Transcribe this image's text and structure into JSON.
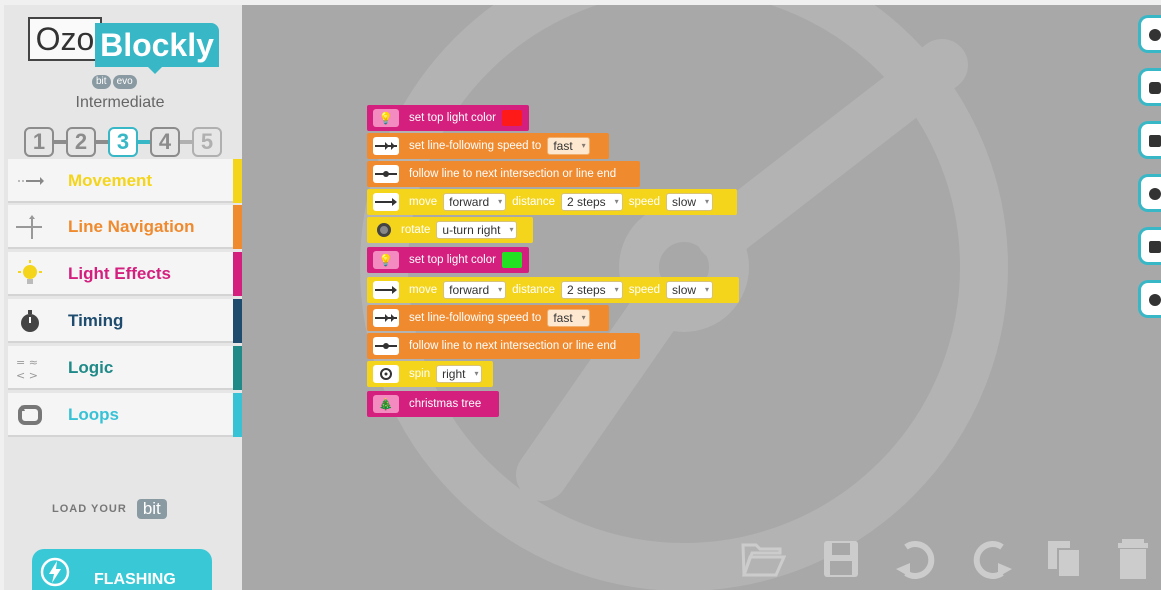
{
  "brand": {
    "ozo": "Ozo",
    "blockly": "Blockly",
    "bit": "bit",
    "evo": "evo"
  },
  "level": {
    "name": "Intermediate",
    "numbers": [
      "1",
      "2",
      "3",
      "4",
      "5"
    ],
    "active": "3"
  },
  "categories": [
    {
      "label": "Movement",
      "color": "#f4d51b",
      "icon": "movement-arrow-icon"
    },
    {
      "label": "Line Navigation",
      "color": "#f08a2e",
      "icon": "line-navigation-icon"
    },
    {
      "label": "Light Effects",
      "color": "#d41f7e",
      "icon": "light-bulb-icon"
    },
    {
      "label": "Timing",
      "color": "#1e4c6e",
      "icon": "stopwatch-icon"
    },
    {
      "label": "Logic",
      "color": "#1f8a88",
      "icon": "logic-icon"
    },
    {
      "label": "Loops",
      "color": "#38c2d6",
      "icon": "loop-icon"
    }
  ],
  "load": {
    "label": "LOAD YOUR",
    "bit": "bit"
  },
  "flash": {
    "label": "FLASHING"
  },
  "blocks": [
    {
      "type": "light",
      "text": "set top light color",
      "swatch": "#ff1a1a"
    },
    {
      "type": "speed",
      "text": "set line-following speed to",
      "value": "fast"
    },
    {
      "type": "follow",
      "text": "follow line to next intersection or line end"
    },
    {
      "type": "move",
      "t1": "move",
      "v1": "forward",
      "t2": "distance",
      "v2": "2 steps",
      "t3": "speed",
      "v3": "slow"
    },
    {
      "type": "rotate",
      "text": "rotate",
      "value": "u-turn right"
    },
    {
      "type": "light",
      "text": "set top light color",
      "swatch": "#22e022"
    },
    {
      "type": "move",
      "t1": "move",
      "v1": "forward",
      "t2": "distance",
      "v2": "2 steps",
      "t3": "speed",
      "v3": "slow"
    },
    {
      "type": "speed",
      "text": "set line-following speed to",
      "value": "fast"
    },
    {
      "type": "follow",
      "text": "follow line to next intersection or line end"
    },
    {
      "type": "spin",
      "text": "spin",
      "value": "right"
    },
    {
      "type": "tree",
      "text": "christmas tree"
    }
  ],
  "toolbar": [
    "open-folder-icon",
    "save-icon",
    "undo-icon",
    "redo-icon",
    "duplicate-icon",
    "trash-icon"
  ],
  "side_buttons": [
    "ozo-icon",
    "robot-icon",
    "window-icon",
    "globe-icon",
    "save-file-icon",
    "settings-icon"
  ]
}
